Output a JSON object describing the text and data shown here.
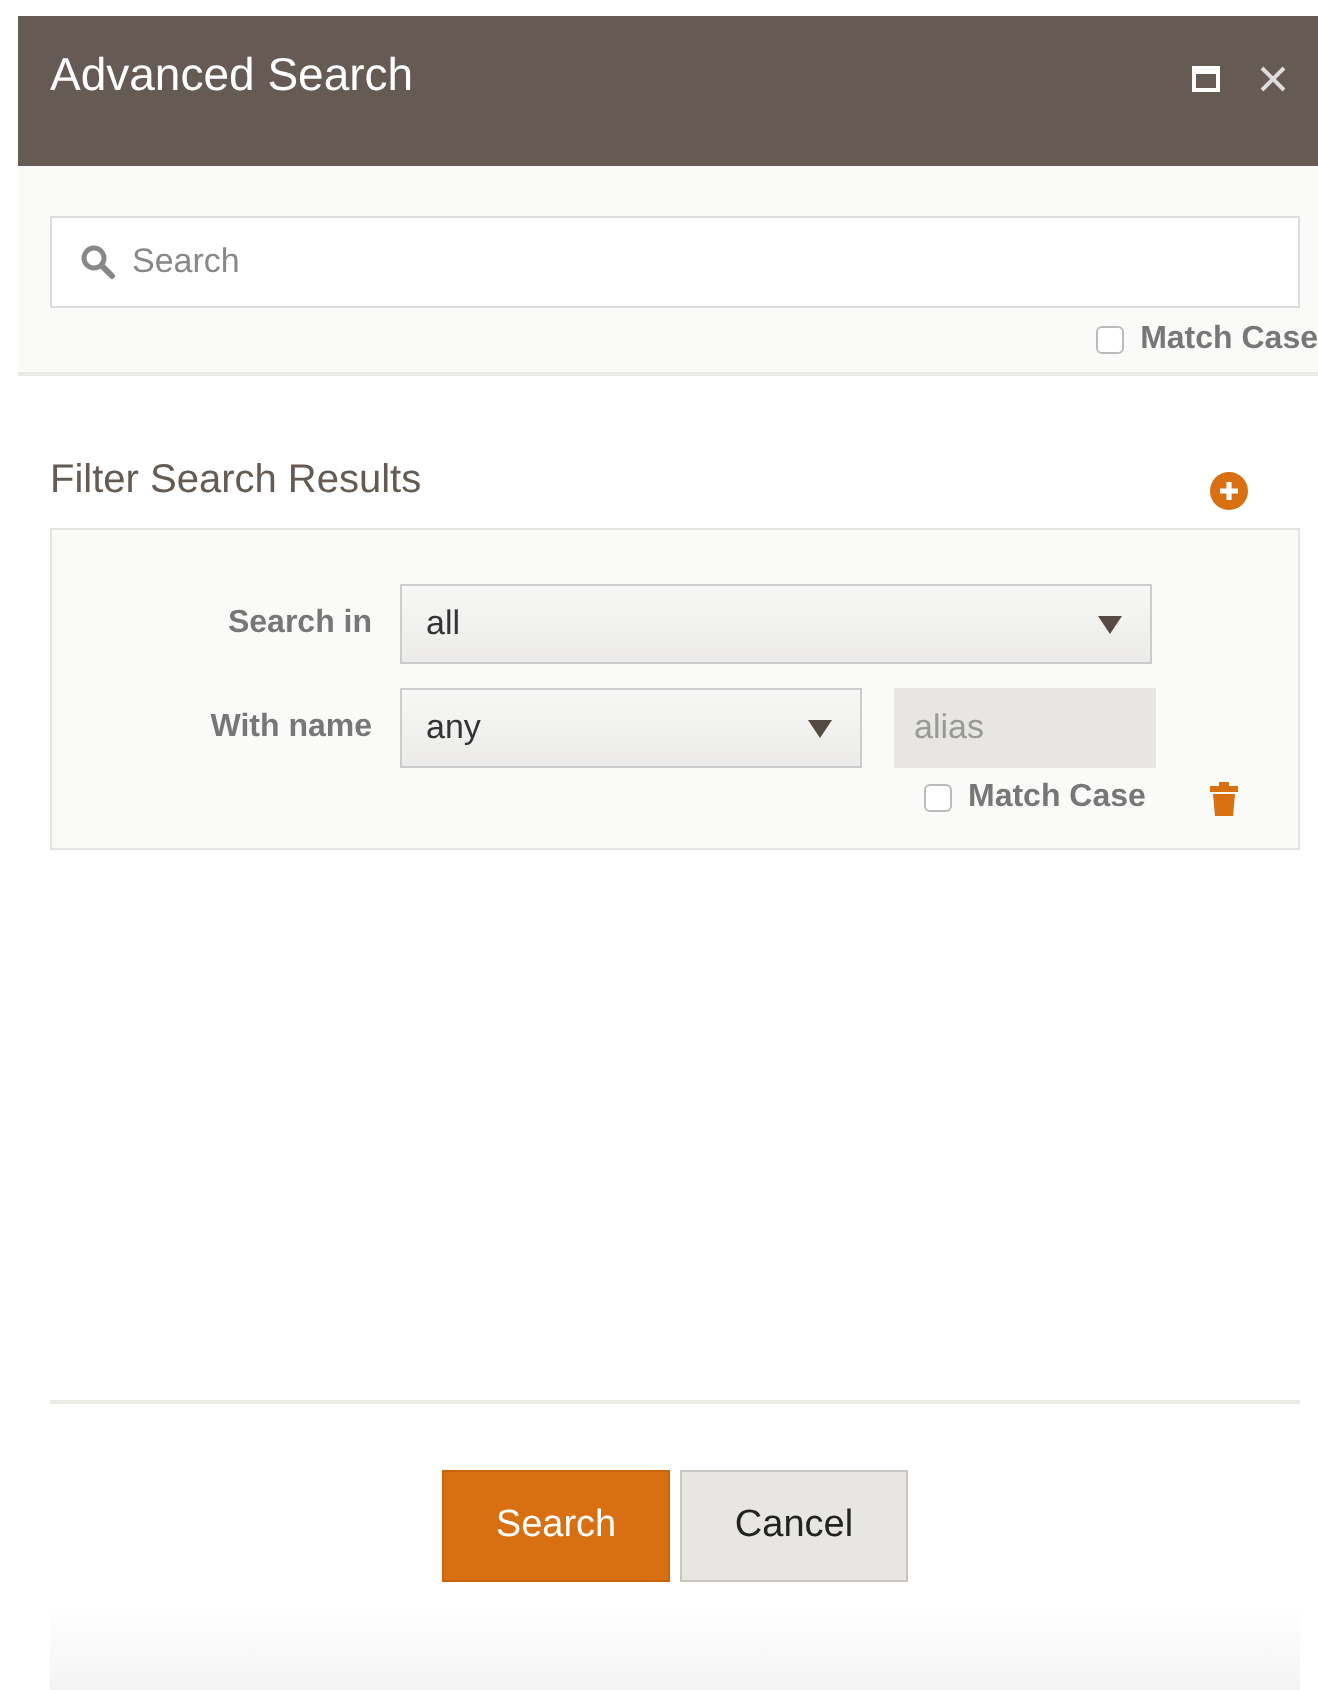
{
  "window": {
    "title": "Advanced Search"
  },
  "search": {
    "placeholder": "Search",
    "match_case": {
      "label": "Match Case",
      "checked": false
    }
  },
  "filter": {
    "title": "Filter Search Results",
    "rows": [
      {
        "label": "Search in",
        "value": "all"
      },
      {
        "label": "With name",
        "value": "any",
        "alias": {
          "placeholder": "alias"
        }
      }
    ],
    "match_case": {
      "label": "Match Case",
      "checked": false
    }
  },
  "buttons": [
    {
      "label": "Search",
      "kind": "primary"
    },
    {
      "label": "Cancel",
      "kind": "secondary"
    }
  ]
}
